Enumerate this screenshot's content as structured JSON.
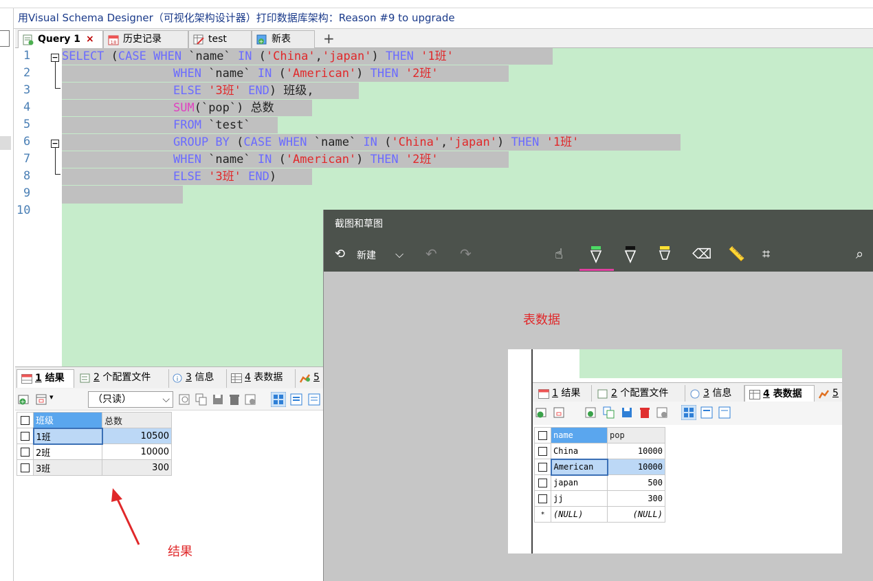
{
  "window_title": "用Visual Schema Designer（可视化架构设计器）打印数据库架构：Reason #9 to upgrade",
  "tabs": [
    {
      "label": "Query 1",
      "close": "×"
    },
    {
      "label": "历史记录"
    },
    {
      "label": "test"
    },
    {
      "label": "新表"
    }
  ],
  "tab_add": "+",
  "line_numbers": [
    "1",
    "2",
    "3",
    "4",
    "5",
    "6",
    "7",
    "8",
    "9",
    "10"
  ],
  "code": {
    "l1": [
      "SELECT",
      " (",
      "CASE",
      " ",
      "WHEN",
      " `name` ",
      "IN",
      " (",
      "'China'",
      ",",
      "'japan'",
      ") ",
      "THEN",
      " ",
      "'1班'"
    ],
    "l2": [
      "WHEN",
      " `name` ",
      "IN",
      " (",
      "'American'",
      ") ",
      "THEN",
      " ",
      "'2班'"
    ],
    "l3": [
      "ELSE",
      " ",
      "'3班'",
      " ",
      "END",
      ") 班级,"
    ],
    "l4": [
      "SUM",
      "(`pop`) 总数"
    ],
    "l5": [
      "FROM",
      " `test`"
    ],
    "l6": [
      "GROUP BY",
      " (",
      "CASE",
      " ",
      "WHEN",
      " `name` ",
      "IN",
      " (",
      "'China'",
      ",",
      "'japan'",
      ") ",
      "THEN",
      " ",
      "'1班'"
    ],
    "l7": [
      "WHEN",
      " `name` ",
      "IN",
      " (",
      "'American'",
      ") ",
      "THEN",
      " ",
      "'2班'"
    ],
    "l8": [
      "ELSE",
      " ",
      "'3班'",
      " ",
      "END",
      ")"
    ]
  },
  "result_tabs": [
    {
      "num": "1",
      "label": "结果"
    },
    {
      "num": "2",
      "label": "个配置文件"
    },
    {
      "num": "3",
      "label": "信息"
    },
    {
      "num": "4",
      "label": "表数据"
    },
    {
      "num": "5",
      "label": ""
    }
  ],
  "readonly_select": "（只读）",
  "result_grid": {
    "headers": [
      "班级",
      "总数"
    ],
    "rows": [
      [
        "1班",
        "10500"
      ],
      [
        "2班",
        "10000"
      ],
      [
        "3班",
        "300"
      ]
    ]
  },
  "annotation_result": "结果",
  "annotation_table": "表数据",
  "snip": {
    "title": "截图和草图",
    "new_label": "新建"
  },
  "table_grid": {
    "headers": [
      "name",
      "pop"
    ],
    "rows": [
      [
        "China",
        "10000"
      ],
      [
        "American",
        "10000"
      ],
      [
        "japan",
        "500"
      ],
      [
        "jj",
        "300"
      ]
    ],
    "new_row": [
      "*",
      "(NULL)",
      "(NULL)"
    ]
  }
}
